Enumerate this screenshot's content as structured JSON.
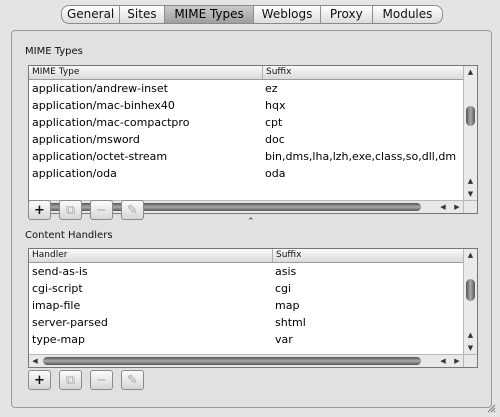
{
  "tabs": [
    {
      "label": "General"
    },
    {
      "label": "Sites"
    },
    {
      "label": "MIME Types"
    },
    {
      "label": "Weblogs"
    },
    {
      "label": "Proxy"
    },
    {
      "label": "Modules"
    }
  ],
  "active_tab": "MIME Types",
  "mime": {
    "section_label": "MIME Types",
    "columns": [
      "MIME Type",
      "Suffix"
    ],
    "rows": [
      [
        "application/andrew-inset",
        "ez"
      ],
      [
        "application/mac-binhex40",
        "hqx"
      ],
      [
        "application/mac-compactpro",
        "cpt"
      ],
      [
        "application/msword",
        "doc"
      ],
      [
        "application/octet-stream",
        "bin,dms,lha,lzh,exe,class,so,dll,dm"
      ],
      [
        "application/oda",
        "oda"
      ]
    ]
  },
  "handlers": {
    "section_label": "Content Handlers",
    "columns": [
      "Handler",
      "Suffix"
    ],
    "rows": [
      [
        "send-as-is",
        "asis"
      ],
      [
        "cgi-script",
        "cgi"
      ],
      [
        "imap-file",
        "map"
      ],
      [
        "server-parsed",
        "shtml"
      ],
      [
        "type-map",
        "var"
      ]
    ]
  },
  "buttons": {
    "add": "+",
    "duplicate": "⧉",
    "remove": "−",
    "edit": "✎"
  },
  "splitter_glyph": "⌃"
}
